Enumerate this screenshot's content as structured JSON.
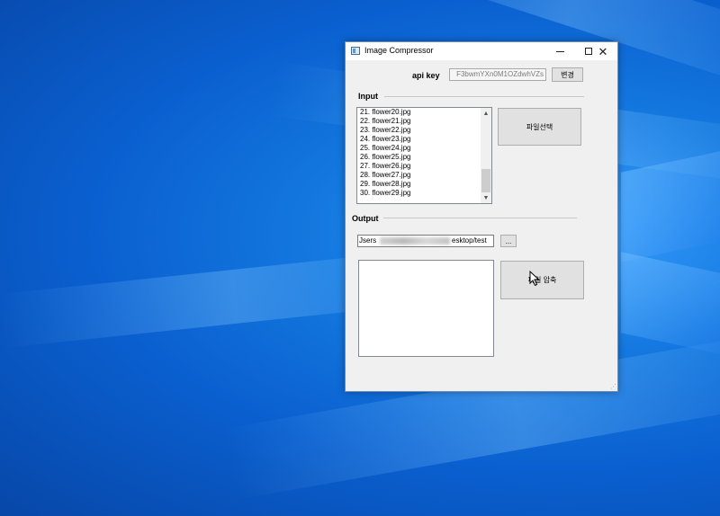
{
  "window": {
    "title": "Image Compressor"
  },
  "api": {
    "label": "api key",
    "value": "F3bwmYXn0M1OZdwhVZs",
    "change_label": "변경"
  },
  "input": {
    "group_label": "Input",
    "files": [
      "21. flower20.jpg",
      "22. flower21.jpg",
      "23. flower22.jpg",
      "24. flower23.jpg",
      "25. flower24.jpg",
      "26. flower25.jpg",
      "27. flower26.jpg",
      "28. flower27.jpg",
      "29. flower28.jpg",
      "30. flower29.jpg"
    ],
    "select_button_label": "파일선택"
  },
  "output": {
    "group_label": "Output",
    "path_prefix": "Jsers",
    "path_suffix": "esktop/test",
    "browse_label": "...",
    "compress_button_label": "파일 압축"
  },
  "colors": {
    "window_bg": "#f0f0f0",
    "desktop_accent": "#1479e0"
  }
}
